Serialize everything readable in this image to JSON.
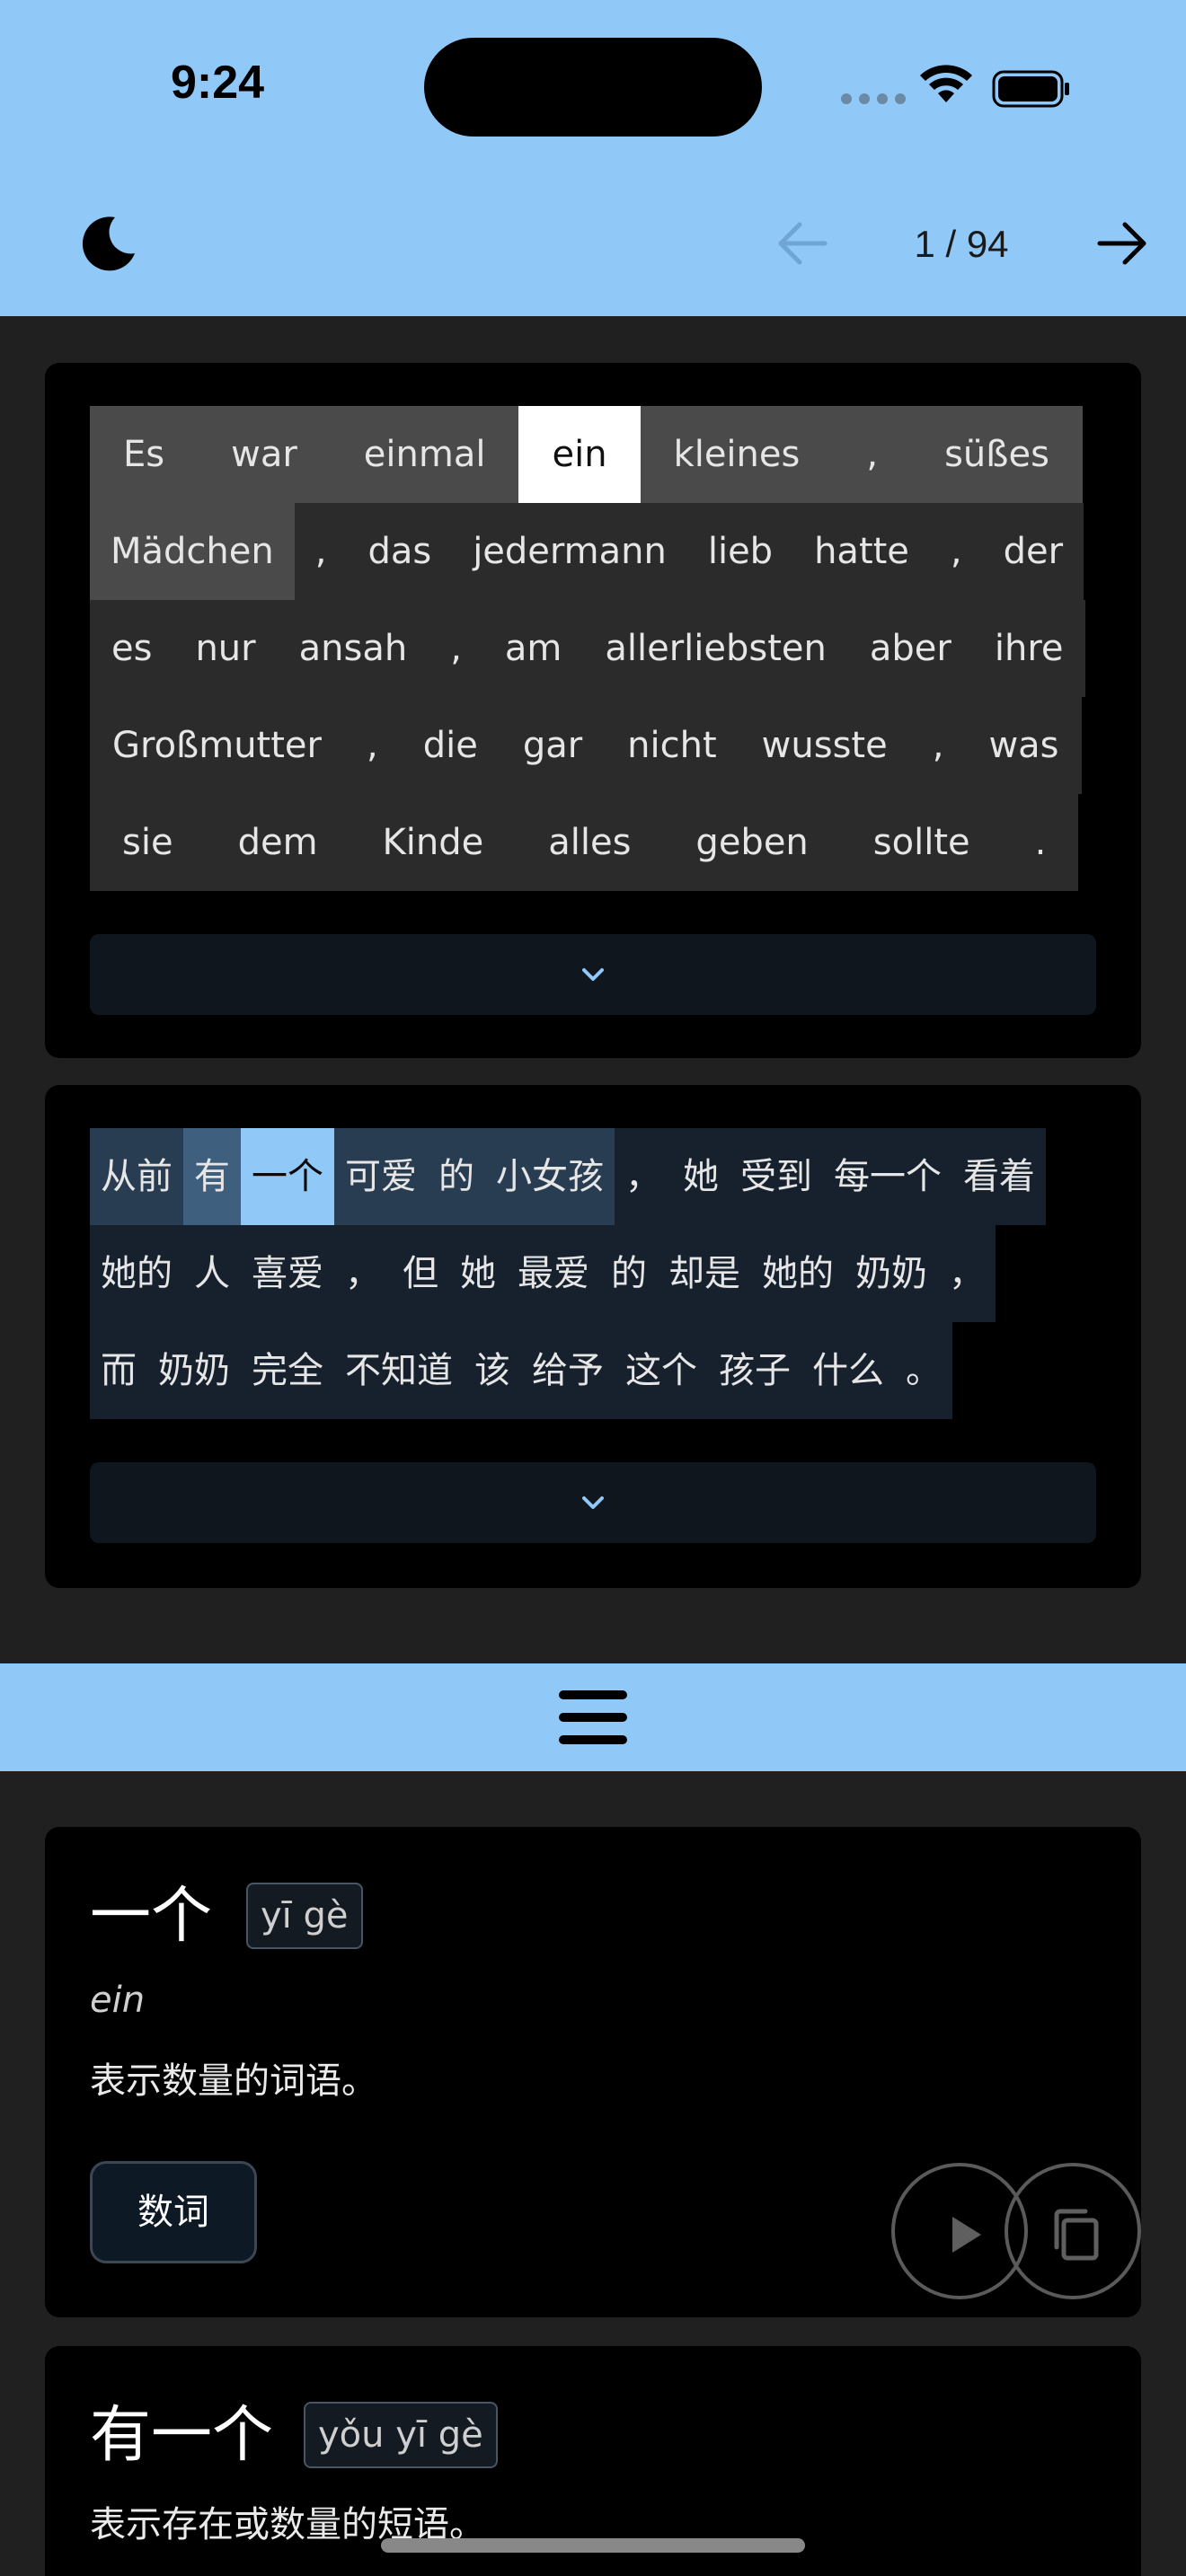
{
  "status_bar": {
    "time": "9:24"
  },
  "nav": {
    "page_indicator": "1 / 94"
  },
  "german_sentence": {
    "lines": [
      [
        {
          "text": "Es",
          "state": "hl"
        },
        {
          "text": "war",
          "state": "hl"
        },
        {
          "text": "einmal",
          "state": "hl"
        },
        {
          "text": "ein",
          "state": "sel"
        },
        {
          "text": "kleines",
          "state": "hl"
        },
        {
          "text": ",",
          "state": "hl"
        },
        {
          "text": "süßes",
          "state": "hl"
        }
      ],
      [
        {
          "text": "Mädchen",
          "state": "hl"
        },
        {
          "text": ",",
          "state": ""
        },
        {
          "text": "das",
          "state": ""
        },
        {
          "text": "jedermann",
          "state": ""
        },
        {
          "text": "lieb",
          "state": ""
        },
        {
          "text": "hatte",
          "state": ""
        },
        {
          "text": ",",
          "state": ""
        },
        {
          "text": "der",
          "state": ""
        }
      ],
      [
        {
          "text": "es",
          "state": ""
        },
        {
          "text": "nur",
          "state": ""
        },
        {
          "text": "ansah",
          "state": ""
        },
        {
          "text": ",",
          "state": ""
        },
        {
          "text": "am",
          "state": ""
        },
        {
          "text": "allerliebsten",
          "state": ""
        },
        {
          "text": "aber",
          "state": ""
        },
        {
          "text": "ihre",
          "state": ""
        }
      ],
      [
        {
          "text": "Großmutter",
          "state": ""
        },
        {
          "text": ",",
          "state": ""
        },
        {
          "text": "die",
          "state": ""
        },
        {
          "text": "gar",
          "state": ""
        },
        {
          "text": "nicht",
          "state": ""
        },
        {
          "text": "wusste",
          "state": ""
        },
        {
          "text": ",",
          "state": ""
        },
        {
          "text": "was",
          "state": ""
        }
      ],
      [
        {
          "text": "sie",
          "state": ""
        },
        {
          "text": "dem",
          "state": ""
        },
        {
          "text": "Kinde",
          "state": ""
        },
        {
          "text": "alles",
          "state": ""
        },
        {
          "text": "geben",
          "state": ""
        },
        {
          "text": "sollte",
          "state": ""
        },
        {
          "text": ".",
          "state": ""
        }
      ]
    ]
  },
  "chinese_sentence": {
    "lines": [
      [
        {
          "text": "从前",
          "state": "hl"
        },
        {
          "text": "有",
          "state": "hl2"
        },
        {
          "text": "一个",
          "state": "sel"
        },
        {
          "text": "可爱",
          "state": "hl"
        },
        {
          "text": "的",
          "state": "hl"
        },
        {
          "text": "小女孩",
          "state": "hl"
        },
        {
          "text": "，",
          "state": ""
        },
        {
          "text": "她",
          "state": ""
        },
        {
          "text": "受到",
          "state": ""
        },
        {
          "text": "每一个",
          "state": ""
        },
        {
          "text": "看着",
          "state": ""
        }
      ],
      [
        {
          "text": "她的",
          "state": ""
        },
        {
          "text": "人",
          "state": ""
        },
        {
          "text": "喜爱",
          "state": ""
        },
        {
          "text": "，",
          "state": ""
        },
        {
          "text": "但",
          "state": ""
        },
        {
          "text": "她",
          "state": ""
        },
        {
          "text": "最爱",
          "state": ""
        },
        {
          "text": "的",
          "state": ""
        },
        {
          "text": "却是",
          "state": ""
        },
        {
          "text": "她的",
          "state": ""
        },
        {
          "text": "奶奶",
          "state": ""
        },
        {
          "text": "，",
          "state": ""
        }
      ],
      [
        {
          "text": "而",
          "state": ""
        },
        {
          "text": "奶奶",
          "state": ""
        },
        {
          "text": "完全",
          "state": ""
        },
        {
          "text": "不知道",
          "state": ""
        },
        {
          "text": "该",
          "state": ""
        },
        {
          "text": "给予",
          "state": ""
        },
        {
          "text": "这个",
          "state": ""
        },
        {
          "text": "孩子",
          "state": ""
        },
        {
          "text": "什么",
          "state": ""
        },
        {
          "text": "。",
          "state": ""
        }
      ]
    ]
  },
  "entries": [
    {
      "headword": "一个",
      "pinyin": "yī gè",
      "translation": "ein",
      "definition": "表示数量的词语。",
      "pos": "数词"
    },
    {
      "headword": "有一个",
      "pinyin": "yǒu yī gè",
      "definition": "表示存在或数量的短语。"
    }
  ],
  "icons": {
    "moon": "moon-icon",
    "back": "arrow-left-icon",
    "forward": "arrow-right-icon",
    "expand": "chevron-down-icon",
    "handle": "hamburger-icon",
    "play": "play-icon",
    "copy": "copy-icon"
  },
  "colors": {
    "accent": "#90c8f8",
    "background": "#202020",
    "card": "#000000"
  }
}
